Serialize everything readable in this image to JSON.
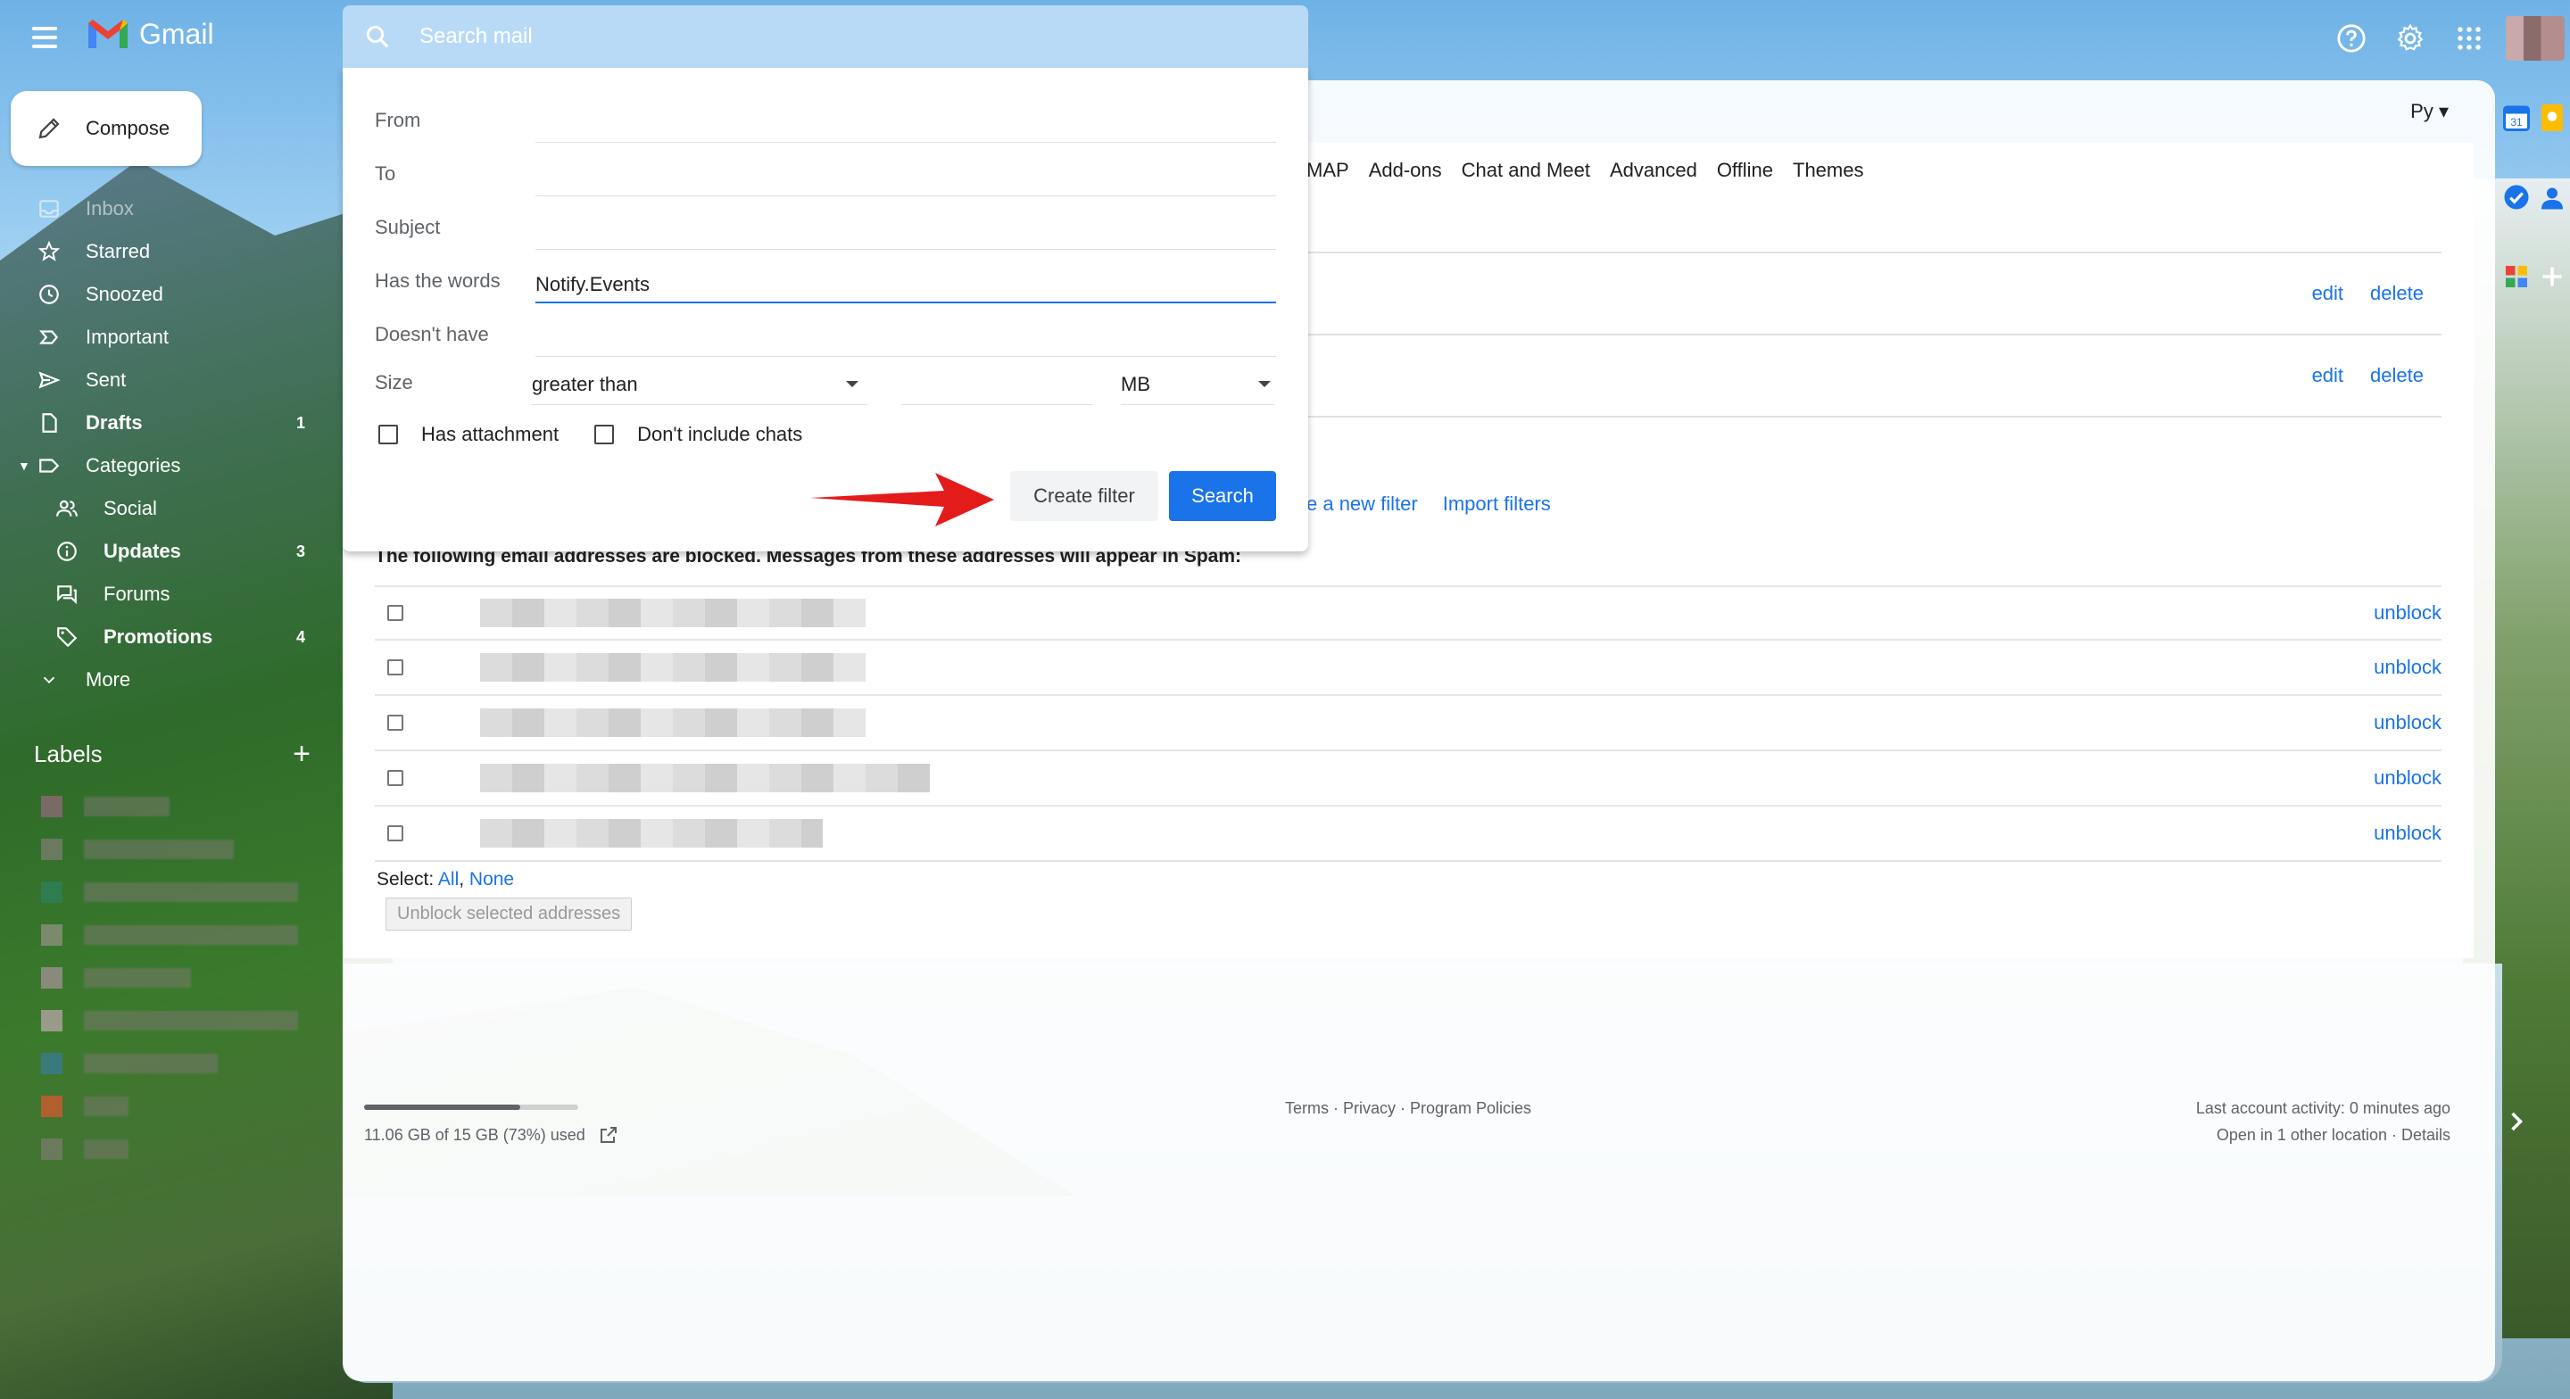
{
  "app": {
    "name": "Gmail"
  },
  "search": {
    "placeholder": "Search mail"
  },
  "compose": {
    "label": "Compose"
  },
  "nav": [
    {
      "label": "Inbox",
      "count": "",
      "bold": false
    },
    {
      "label": "Starred",
      "count": "",
      "bold": false
    },
    {
      "label": "Snoozed",
      "count": "",
      "bold": false
    },
    {
      "label": "Important",
      "count": "",
      "bold": false
    },
    {
      "label": "Sent",
      "count": "",
      "bold": false
    },
    {
      "label": "Drafts",
      "count": "1",
      "bold": true
    },
    {
      "label": "Categories",
      "count": "",
      "bold": false
    },
    {
      "label": "Social",
      "count": "",
      "bold": false
    },
    {
      "label": "Updates",
      "count": "3",
      "bold": true
    },
    {
      "label": "Forums",
      "count": "",
      "bold": false
    },
    {
      "label": "Promotions",
      "count": "4",
      "bold": true
    },
    {
      "label": "More",
      "count": "",
      "bold": false
    }
  ],
  "labels": {
    "title": "Labels"
  },
  "settings": {
    "language": "Ру",
    "tabs": [
      "MAP",
      "Add-ons",
      "Chat and Meet",
      "Advanced",
      "Offline",
      "Themes"
    ],
    "filter_actions": {
      "edit": "edit",
      "delete": "delete"
    },
    "links": {
      "create": "e a new filter",
      "import": "Import filters"
    },
    "blocked_title": "The following email addresses are blocked. Messages from these addresses will appear in Spam:",
    "unblock": "unblock",
    "select_label": "Select:",
    "select_all": "All",
    "select_none": "None",
    "unblock_selected": "Unblock selected addresses"
  },
  "search_options": {
    "from": "From",
    "to": "To",
    "subject": "Subject",
    "has_words": "Has the words",
    "has_words_value": "Notify.Events",
    "doesnt_have": "Doesn't have",
    "size": "Size",
    "size_op": "greater than",
    "size_unit": "MB",
    "has_attachment": "Has attachment",
    "no_chats": "Don't include chats",
    "create_filter": "Create filter",
    "search_btn": "Search"
  },
  "footer": {
    "storage": "11.06 GB of 15 GB (73%) used",
    "storage_fraction": 0.73,
    "links": "Terms · Privacy · Program Policies",
    "activity": "Last account activity: 0 minutes ago",
    "other": "Open in 1 other location · Details"
  },
  "colors": {
    "accent": "#1a73e8",
    "arrow": "#e31b1b"
  }
}
